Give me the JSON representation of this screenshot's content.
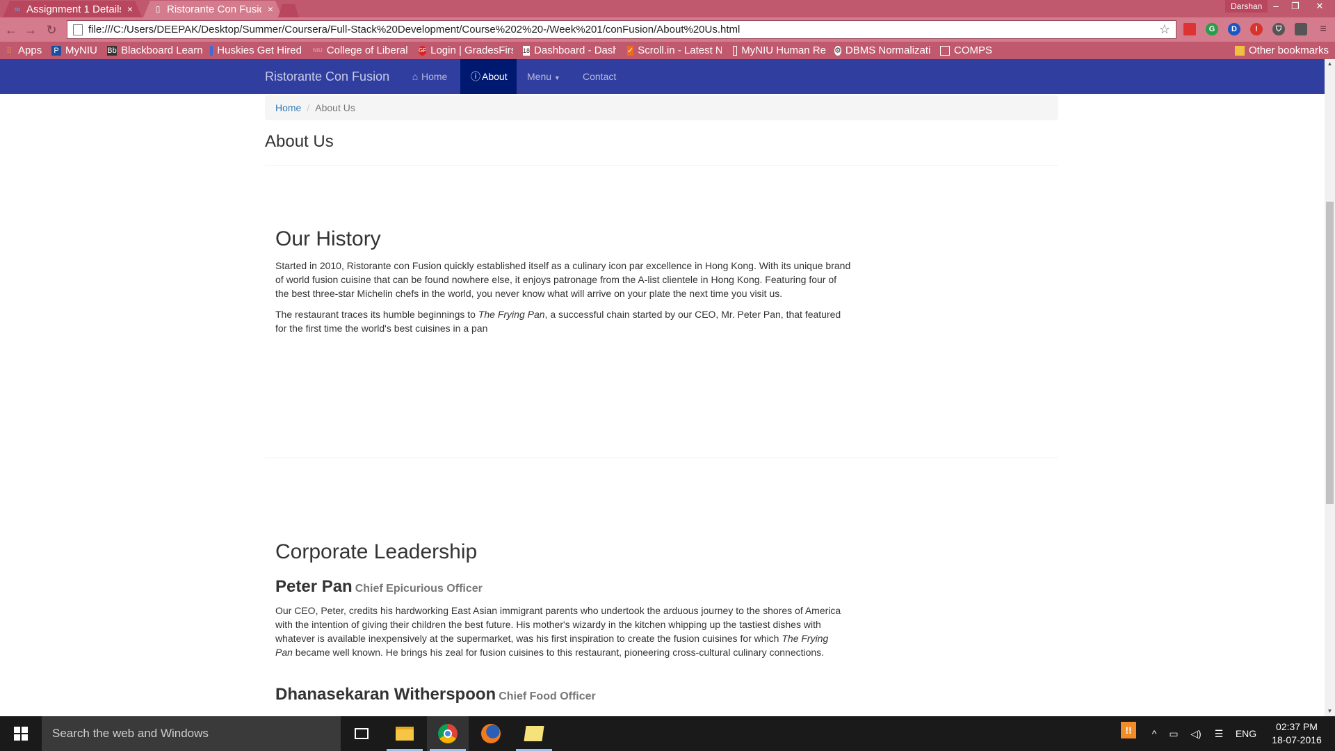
{
  "browser": {
    "tabs": [
      {
        "title": "Assignment 1 Details",
        "icon": "∞",
        "active": false
      },
      {
        "title": "Ristorante Con Fusion",
        "icon": "▯",
        "active": true
      }
    ],
    "profile_name": "Darshan",
    "url": "file:///C:/Users/DEEPAK/Desktop/Summer/Coursera/Full-Stack%20Development/Course%202%20-/Week%201/conFusion/About%20Us.html",
    "bookmarks": [
      {
        "label": "Apps",
        "icon": "apps-grid-icon"
      },
      {
        "label": "MyNIU",
        "icon": "p-icon"
      },
      {
        "label": "Blackboard Learn",
        "icon": "bb-icon"
      },
      {
        "label": "Huskies Get Hired",
        "icon": "square-icon"
      },
      {
        "label": "College of Liberal",
        "icon": "niu-icon"
      },
      {
        "label": "Login | GradesFirst",
        "icon": "gf-icon"
      },
      {
        "label": "Dashboard - Dashboard",
        "icon": "calendar-icon"
      },
      {
        "label": "Scroll.in - Latest N",
        "icon": "scroll-icon"
      },
      {
        "label": "MyNIU Human Re",
        "icon": "page-icon"
      },
      {
        "label": "DBMS Normalization",
        "icon": "dbms-icon"
      },
      {
        "label": "COMPS",
        "icon": "page-icon"
      }
    ],
    "other_bookmarks": "Other bookmarks"
  },
  "navbar": {
    "brand": "Ristorante Con Fusion",
    "items": [
      {
        "label": "Home"
      },
      {
        "label": "About"
      },
      {
        "label": "Menu"
      },
      {
        "label": "Contact"
      }
    ]
  },
  "breadcrumb": {
    "home": "Home",
    "separator": "/",
    "current": "About Us"
  },
  "page": {
    "title": "About Us",
    "history": {
      "title": "Our History",
      "p1": "Started in 2010, Ristorante con Fusion quickly established itself as a culinary icon par excellence in Hong Kong. With its unique brand of world fusion cuisine that can be found nowhere else, it enjoys patronage from the A-list clientele in Hong Kong. Featuring four of the best three-star Michelin chefs in the world, you never know what will arrive on your plate the next time you visit us.",
      "p2_before": "The restaurant traces its humble beginnings to ",
      "p2_em": "The Frying Pan",
      "p2_after": ", a successful chain started by our CEO, Mr. Peter Pan, that featured for the first time the world's best cuisines in a pan"
    },
    "leadership": {
      "title": "Corporate Leadership",
      "leaders": [
        {
          "name": "Peter Pan",
          "role": "Chief Epicurious Officer",
          "bio_before": "Our CEO, Peter, credits his hardworking East Asian immigrant parents who undertook the arduous journey to the shores of America with the intention of giving their children the best future. His mother's wizardy in the kitchen whipping up the tastiest dishes with whatever is available inexpensively at the supermarket, was his first inspiration to create the fusion cuisines for which ",
          "bio_em": "The Frying Pan",
          "bio_after": " became well known. He brings his zeal for fusion cuisines to this restaurant, pioneering cross-cultural culinary connections."
        },
        {
          "name": "Dhanasekaran Witherspoon",
          "role": "Chief Food Officer"
        }
      ]
    }
  },
  "taskbar": {
    "search_placeholder": "Search the web and Windows",
    "language": "ENG",
    "time": "02:37 PM",
    "date": "18-07-2016"
  },
  "colors": {
    "navbar": "#303f9f",
    "navbar_active": "#001970",
    "chrome": "#c0596e"
  }
}
